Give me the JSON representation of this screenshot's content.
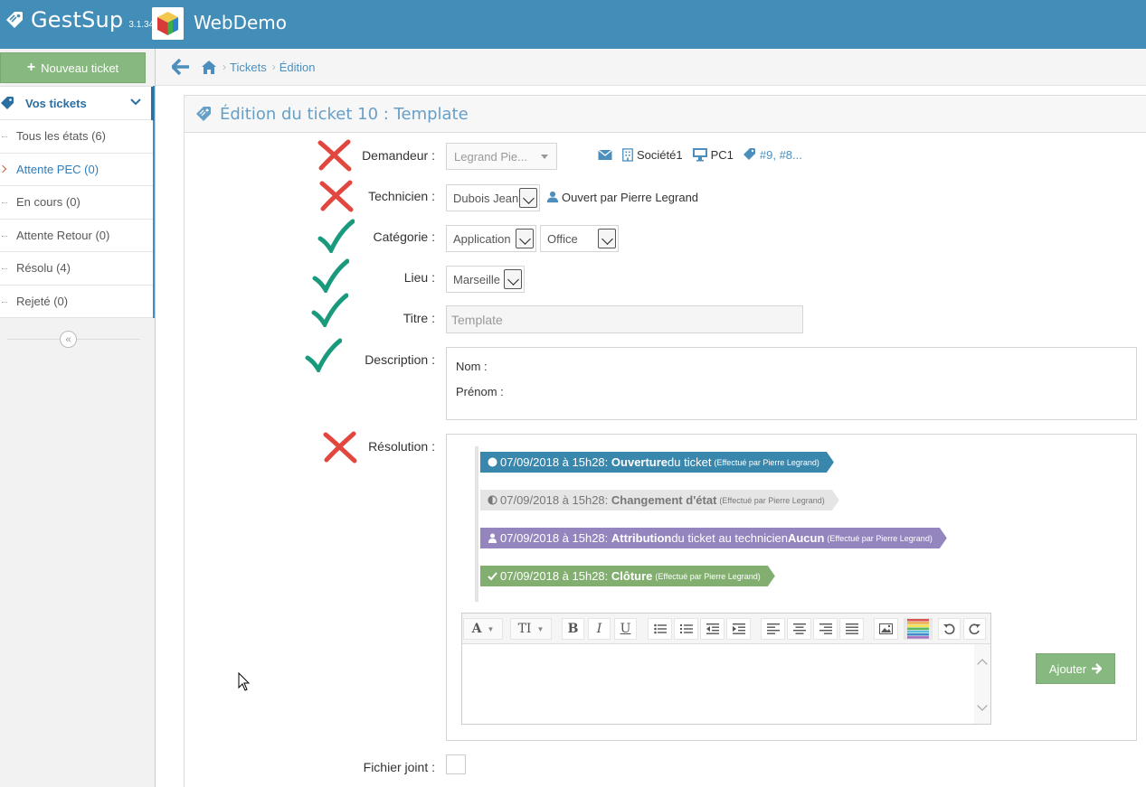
{
  "header": {
    "brand": "GestSup",
    "version": "3.1.34",
    "company": "WebDemo"
  },
  "sidebar": {
    "new_ticket": "Nouveau ticket",
    "section_title": "Vos tickets",
    "items": [
      {
        "label": "Tous les états (6)"
      },
      {
        "label": "Attente PEC (0)"
      },
      {
        "label": "En cours (0)"
      },
      {
        "label": "Attente Retour (0)"
      },
      {
        "label": "Résolu (4)"
      },
      {
        "label": "Rejeté (0)"
      }
    ],
    "collapse_icon": "double-chevron-left-icon"
  },
  "breadcrumb": {
    "items": [
      "Tickets",
      "Édition"
    ]
  },
  "widget": {
    "title": "Édition du ticket 10 : Template"
  },
  "form": {
    "demandeur": {
      "label": "Demandeur :",
      "value": "Legrand Pie..."
    },
    "demandeur_info": {
      "company": "Société1",
      "pc": "PC1",
      "tickets": "#9, #8..."
    },
    "technicien": {
      "label": "Technicien :",
      "value": "Dubois Jean",
      "opened_by": "Ouvert par Pierre Legrand"
    },
    "categorie": {
      "label": "Catégorie :",
      "value1": "Application",
      "value2": "Office"
    },
    "lieu": {
      "label": "Lieu :",
      "value": "Marseille"
    },
    "titre": {
      "label": "Titre :",
      "value": "Template"
    },
    "description": {
      "label": "Description :",
      "line1": "Nom :",
      "line2": "Prénom :"
    },
    "resolution": {
      "label": "Résolution :"
    },
    "fichier": {
      "label": "Fichier joint :"
    }
  },
  "events": [
    {
      "date": "07/09/2018 à 15h28:",
      "bold": "Ouverture",
      "text": " du ticket",
      "by": "(Effectué par Pierre Legrand)",
      "color": "#3a87ad"
    },
    {
      "date": "07/09/2018 à 15h28:",
      "bold": "Changement d'état",
      "text": "",
      "by": "(Effectué par Pierre Legrand)",
      "color": "#e5e5e5"
    },
    {
      "date": "07/09/2018 à 15h28:",
      "bold": "Attribution",
      "text": " du ticket au technicien ",
      "bold2": "Aucun",
      "by": "(Effectué par Pierre Legrand)",
      "color": "#9585bf"
    },
    {
      "date": "07/09/2018 à 15h28:",
      "bold": "Clôture",
      "text": "",
      "by": "(Effectué par Pierre Legrand)",
      "color": "#82af6f"
    }
  ],
  "editor": {
    "add_button": "Ajouter"
  },
  "marks": {
    "demandeur": "cross",
    "technicien": "cross",
    "categorie": "check",
    "lieu": "check",
    "titre": "check",
    "description": "check",
    "resolution": "cross"
  },
  "colors": {
    "navbar": "#438eb9",
    "success": "#87b87f",
    "cross": "#e2473f",
    "check": "#1a9a7c"
  }
}
